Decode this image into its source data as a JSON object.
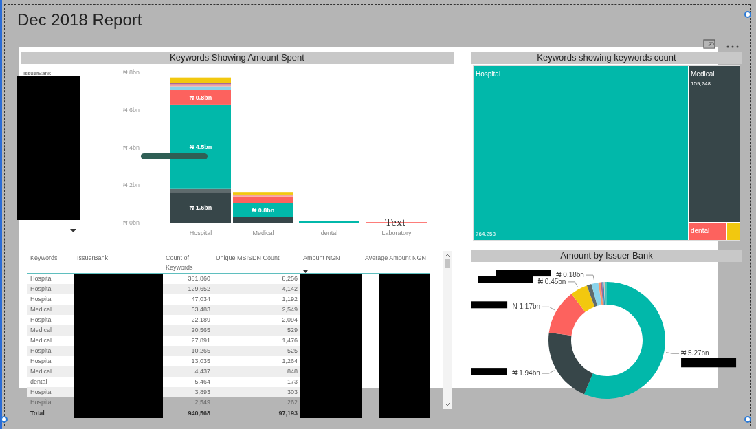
{
  "report_title": "Dec 2018 Report",
  "spend_visual": {
    "header": "Keywords Showing Amount Spent",
    "slicer": {
      "label": "IssuerBank"
    },
    "stray_text": "Text",
    "chart_data": {
      "type": "bar",
      "stacked": true,
      "categories": [
        "Hospital",
        "Medical",
        "dental",
        "Laboratory"
      ],
      "ylim": [
        0,
        8
      ],
      "yticks": [
        {
          "value": 0,
          "label": "₦ 0bn"
        },
        {
          "value": 2,
          "label": "₦ 2bn"
        },
        {
          "value": 4,
          "label": "₦ 4bn"
        },
        {
          "value": 6,
          "label": "₦ 6bn"
        },
        {
          "value": 8,
          "label": "₦ 8bn"
        }
      ],
      "series": [
        {
          "color": "#374649",
          "values": [
            1.6,
            0.3,
            null,
            null
          ],
          "value_labels": [
            "₦ 1.6bn",
            null,
            null,
            null
          ]
        },
        {
          "color": "#5f6b6d",
          "values": [
            0.2,
            null,
            null,
            null
          ]
        },
        {
          "color": "#01b8aa",
          "values": [
            4.45,
            0.75,
            0.08,
            null
          ],
          "value_labels": [
            "₦ 4.5bn",
            "₦ 0.8bn",
            null,
            null
          ]
        },
        {
          "color": "#fd625e",
          "values": [
            0.8,
            0.35,
            null,
            0.03
          ],
          "value_labels": [
            "₦ 0.8bn",
            null,
            null,
            null
          ]
        },
        {
          "color": "#8ad4eb",
          "values": [
            0.2,
            null,
            null,
            null
          ]
        },
        {
          "color": "#f4a3a0",
          "values": [
            0.12,
            0.1,
            null,
            null
          ]
        },
        {
          "color": "#a66999",
          "values": [
            0.05,
            null,
            null,
            null
          ]
        },
        {
          "color": "#f2c80f",
          "values": [
            0.3,
            0.1,
            null,
            null
          ]
        }
      ]
    }
  },
  "table": {
    "columns": [
      {
        "label": "Keywords",
        "sorted": false
      },
      {
        "label": "IssuerBank",
        "sorted": false
      },
      {
        "label": "Count of Keywords",
        "sorted": false
      },
      {
        "label": "Unique MSISDN Count",
        "sorted": false
      },
      {
        "label": "Amount NGN",
        "sorted": true
      },
      {
        "label": "Average Amount NGN",
        "sorted": false
      }
    ],
    "rows": [
      {
        "keyword": "Hospital",
        "count": "381,860",
        "unique": "8,256"
      },
      {
        "keyword": "Hospital",
        "count": "129,652",
        "unique": "4,142"
      },
      {
        "keyword": "Hospital",
        "count": "47,034",
        "unique": "1,192"
      },
      {
        "keyword": "Medical",
        "count": "63,483",
        "unique": "2,549"
      },
      {
        "keyword": "Hospital",
        "count": "22,189",
        "unique": "2,094"
      },
      {
        "keyword": "Medical",
        "count": "20,565",
        "unique": "529"
      },
      {
        "keyword": "Medical",
        "count": "27,891",
        "unique": "1,476"
      },
      {
        "keyword": "Hospital",
        "count": "10,265",
        "unique": "525"
      },
      {
        "keyword": "Hospital",
        "count": "13,035",
        "unique": "1,264"
      },
      {
        "keyword": "Medical",
        "count": "4,437",
        "unique": "848"
      },
      {
        "keyword": "dental",
        "count": "5,464",
        "unique": "173"
      },
      {
        "keyword": "Hospital",
        "count": "3,893",
        "unique": "303"
      },
      {
        "keyword": "Hospital",
        "count": "2,549",
        "unique": "262"
      }
    ],
    "total": {
      "label": "Total",
      "count": "940,568",
      "unique": "97,193"
    }
  },
  "treemap": {
    "header": "Keywords showing keywords count",
    "tiles": [
      {
        "label": "Hospital",
        "value": "764,258",
        "color": "#01b8aa"
      },
      {
        "label": "Medical",
        "value": "159,248",
        "color": "#374649"
      },
      {
        "label": "dental",
        "color": "#fd625e"
      },
      {
        "color": "#f2c80f"
      }
    ]
  },
  "donut": {
    "header": "Amount by Issuer Bank",
    "chart_data": {
      "type": "donut",
      "values": [
        5.27,
        1.94,
        1.17,
        0.45,
        0.12,
        0.18,
        0.06,
        0.04,
        0.04,
        0.03,
        0.05
      ],
      "colors": [
        "#01b8aa",
        "#374649",
        "#fd625e",
        "#f2c80f",
        "#5f6b6d",
        "#8ad4eb",
        "#fe9666",
        "#a66999",
        "#3599b8",
        "#dfbfbf",
        "#4ac5bb"
      ],
      "value_labels": [
        "₦ 5.27bn",
        "₦ 1.94bn",
        "₦ 1.17bn",
        "₦ 0.45bn",
        null,
        "₦ 0.18bn",
        null,
        null,
        null,
        null,
        null
      ]
    }
  }
}
